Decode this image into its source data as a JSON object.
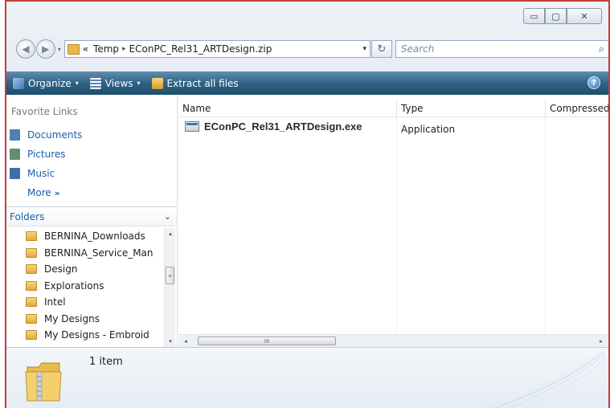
{
  "window": {
    "caption": {
      "minimize": "▭",
      "maximize": "▢",
      "close": "✕"
    }
  },
  "address_bar": {
    "prefix": "«",
    "crumbs": [
      "Temp",
      "EConPC_Rel31_ARTDesign.zip"
    ],
    "separator": "▸",
    "dropdown": "▾",
    "refresh": "↻"
  },
  "search": {
    "placeholder": "Search",
    "icon": "⌕"
  },
  "toolbar": {
    "organize": "Organize",
    "views": "Views",
    "extract": "Extract all files",
    "caret": "▾",
    "help": "?"
  },
  "nav_pane": {
    "favorite_links_title": "Favorite Links",
    "favorites": [
      {
        "label": "Documents",
        "color": "#4f7fb3"
      },
      {
        "label": "Pictures",
        "color": "#5f8f6f"
      },
      {
        "label": "Music",
        "color": "#3d6fa7"
      }
    ],
    "more": "More",
    "more_glyph": "»",
    "folders_title": "Folders",
    "folders_chevron": "⌄",
    "tree": [
      "BERNINA_Downloads",
      "BERNINA_Service_Man",
      "Design",
      "Explorations",
      "Intel",
      "My Designs",
      "My Designs - Embroid"
    ]
  },
  "file_list": {
    "columns": [
      "Name",
      "Type",
      "Compressed"
    ],
    "sort_glyph": "^",
    "rows": [
      {
        "name": "EConPC_Rel31_ARTDesign.exe",
        "type": "Application"
      }
    ]
  },
  "scrollbars": {
    "left": "◂",
    "right": "▸",
    "up": "▴",
    "down": "▾",
    "grip": "III",
    "vgrip": "≡"
  },
  "details": {
    "count": "1 item"
  },
  "colors": {
    "accent_border": "#c43c3c",
    "toolbar": "#2f6284",
    "link": "#1a5fa8"
  }
}
